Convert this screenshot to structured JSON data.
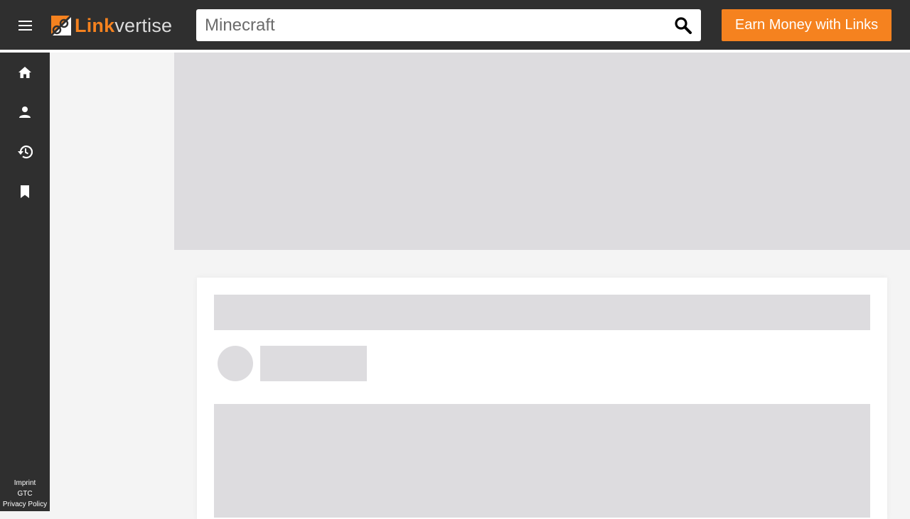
{
  "header": {
    "logo_part1": "Link",
    "logo_part2": "vertise",
    "menu_icon": "hamburger-menu-icon",
    "search": {
      "value": "",
      "placeholder": "Minecraft",
      "icon": "search-icon"
    },
    "cta_label": "Earn Money with Links"
  },
  "sidebar": {
    "items": [
      {
        "name": "home",
        "icon": "home-icon"
      },
      {
        "name": "profile",
        "icon": "person-icon"
      },
      {
        "name": "history",
        "icon": "history-icon"
      },
      {
        "name": "bookmarks",
        "icon": "bookmark-icon"
      }
    ],
    "footer": [
      "Imprint",
      "GTC",
      "Privacy Policy"
    ]
  },
  "colors": {
    "brand_orange": "#f5821f",
    "topbar": "#2f2f2f",
    "skeleton": "#dddcdf",
    "background": "#f4f4f4"
  }
}
